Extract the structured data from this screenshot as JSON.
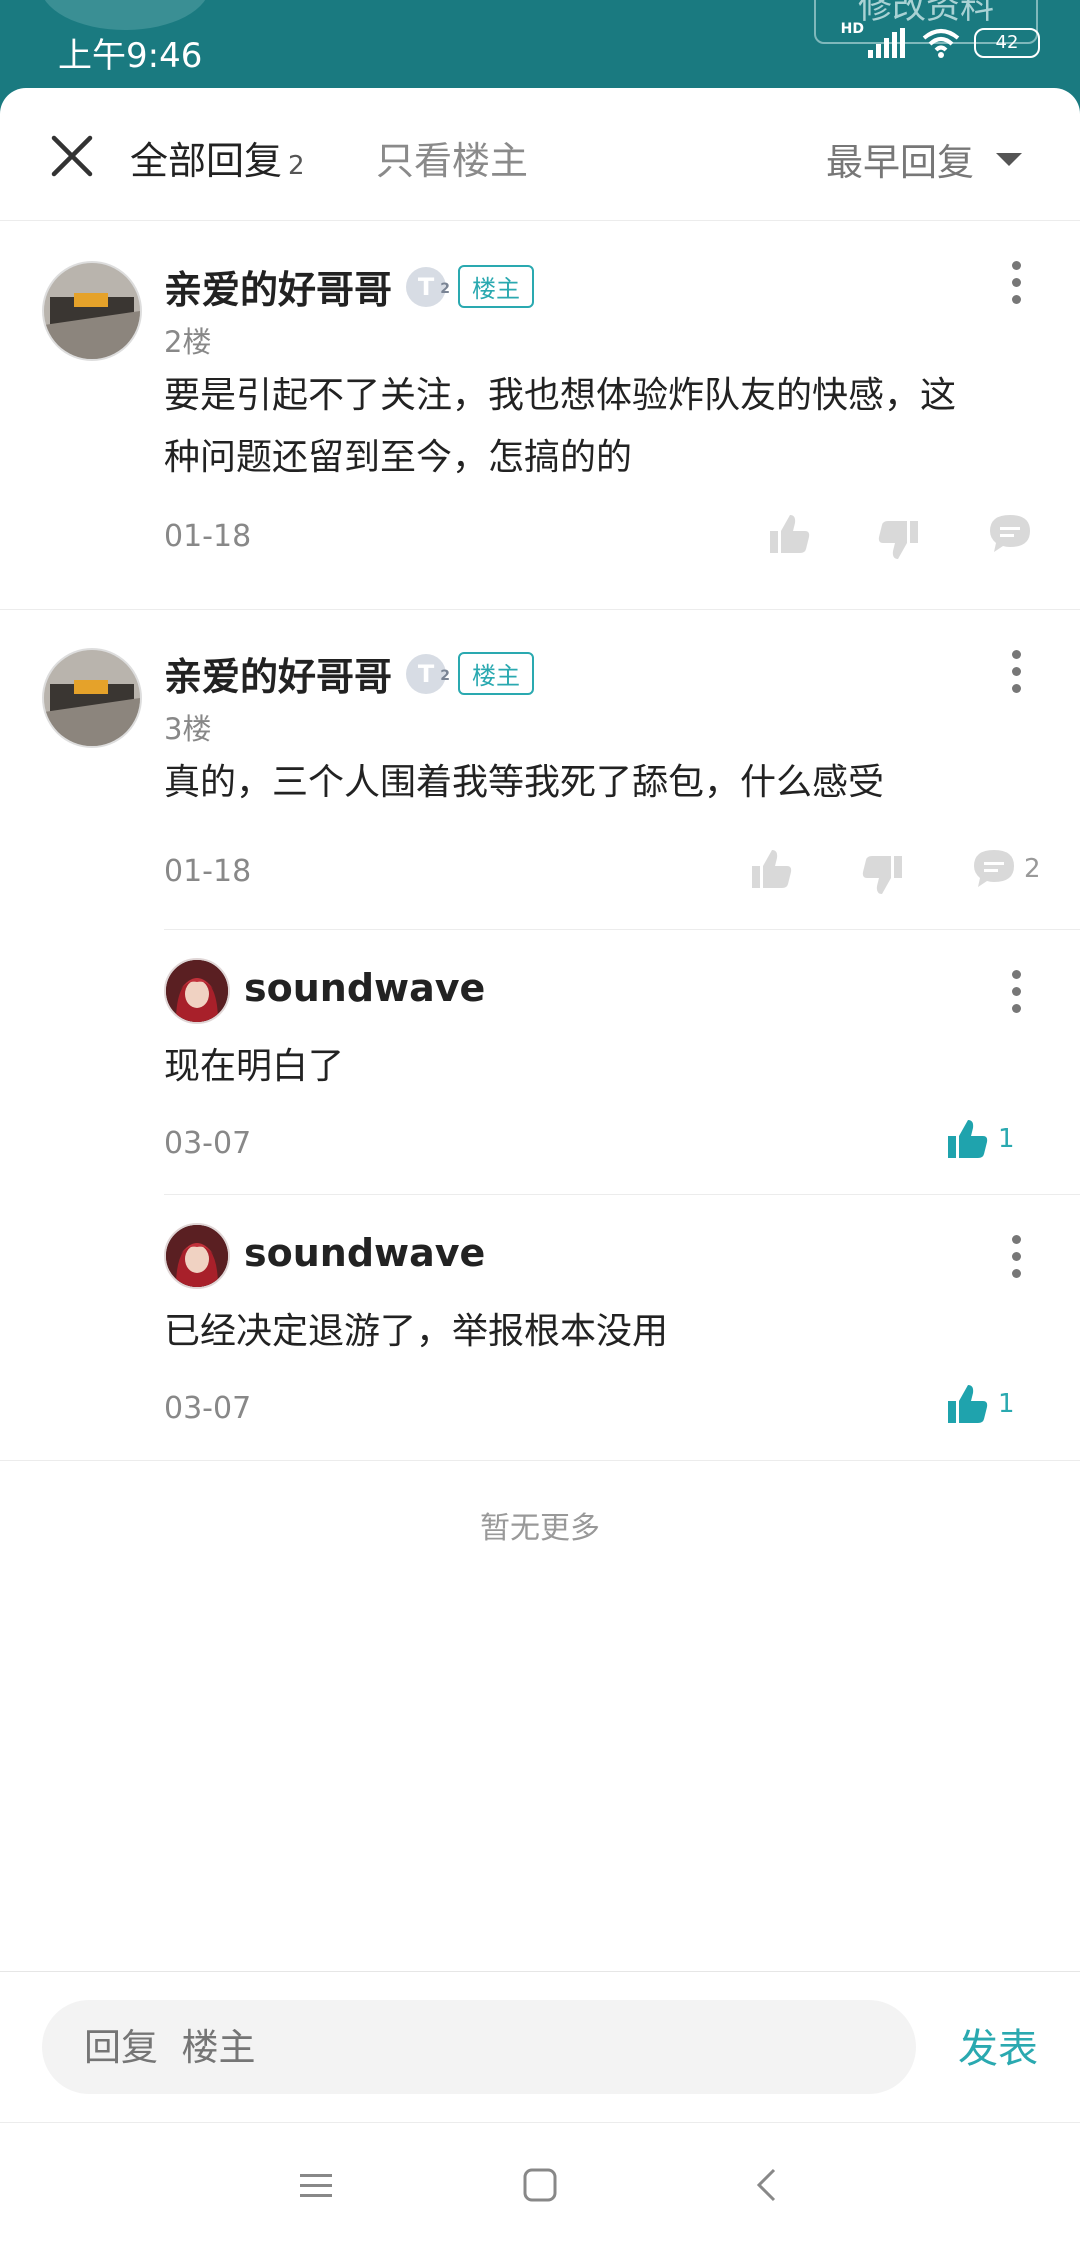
{
  "status_bar": {
    "time": "上午9:46",
    "hd": "HD",
    "battery": "42"
  },
  "backdrop": {
    "edit_button": "修改资料"
  },
  "header": {
    "tab_all": "全部回复",
    "tab_all_count": "2",
    "tab_owner_only": "只看楼主",
    "sort_label": "最早回复"
  },
  "posts": [
    {
      "username": "亲爱的好哥哥",
      "level_badge": "T",
      "level_sub": "2",
      "owner_badge": "楼主",
      "floor": "2楼",
      "content_line1": "要是引起不了关注，我也想体验炸队友的快感，这",
      "content_line2": "种问题还留到至今，怎搞的的",
      "date": "01-18"
    },
    {
      "username": "亲爱的好哥哥",
      "level_badge": "T",
      "level_sub": "2",
      "owner_badge": "楼主",
      "floor": "3楼",
      "content": "真的，三个人围着我等我死了舔包，什么感受",
      "date": "01-18",
      "reply_count": "2",
      "replies": [
        {
          "username": "soundwave",
          "content": "现在明白了",
          "date": "03-07",
          "likes": "1"
        },
        {
          "username": "soundwave",
          "content": "已经决定退游了，举报根本没用",
          "date": "03-07",
          "likes": "1"
        }
      ]
    }
  ],
  "footer": {
    "no_more": "暂无更多"
  },
  "reply_bar": {
    "placeholder": "回复  楼主",
    "publish": "发表"
  },
  "colors": {
    "accent": "#2aa9b0",
    "header_bg": "#1a7a80",
    "like_active": "#1fa3ad"
  },
  "icons": [
    "close-icon",
    "caret-down-icon",
    "more-icon",
    "thumb-up-icon",
    "thumb-down-icon",
    "comment-icon",
    "menu-icon",
    "home-icon",
    "back-icon"
  ]
}
